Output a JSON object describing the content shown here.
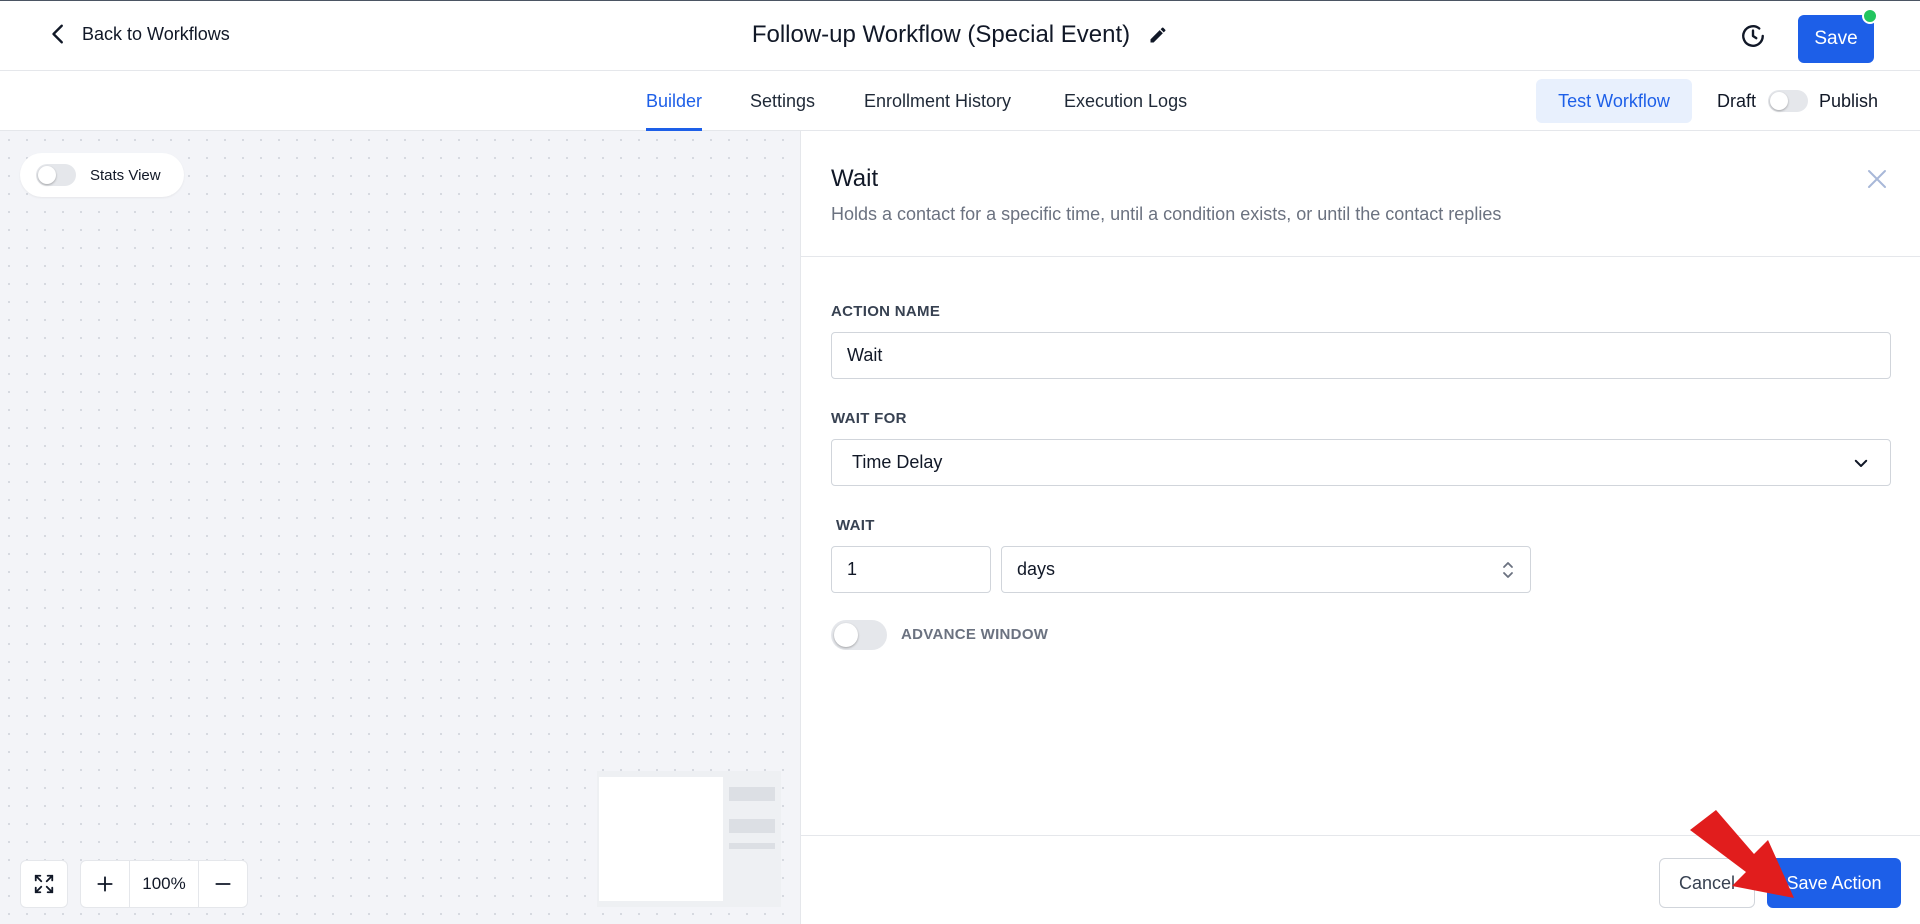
{
  "header": {
    "back_label": "Back to Workflows",
    "workflow_title": "Follow-up Workflow (Special Event)",
    "save_label": "Save"
  },
  "tabs": [
    {
      "label": "Builder",
      "active": true
    },
    {
      "label": "Settings",
      "active": false
    },
    {
      "label": "Enrollment History",
      "active": false
    },
    {
      "label": "Execution Logs",
      "active": false
    }
  ],
  "toolbar": {
    "test_label": "Test Workflow",
    "draft_label": "Draft",
    "publish_label": "Publish"
  },
  "canvas": {
    "stats_label": "Stats View",
    "zoom_level": "100%"
  },
  "panel": {
    "title": "Wait",
    "description": "Holds a contact for a specific time, until a condition exists, or until the contact replies",
    "action_name_label": "ACTION NAME",
    "action_name_value": "Wait",
    "wait_for_label": "WAIT FOR",
    "wait_for_value": "Time Delay",
    "wait_label": "WAIT",
    "wait_amount": "1",
    "wait_unit": "days",
    "advance_window_label": "ADVANCE WINDOW",
    "cancel_label": "Cancel",
    "save_action_label": "Save Action"
  },
  "colors": {
    "primary": "#1d5fe8",
    "status_dot": "#22c55e",
    "annotation": "#e11d1d"
  }
}
